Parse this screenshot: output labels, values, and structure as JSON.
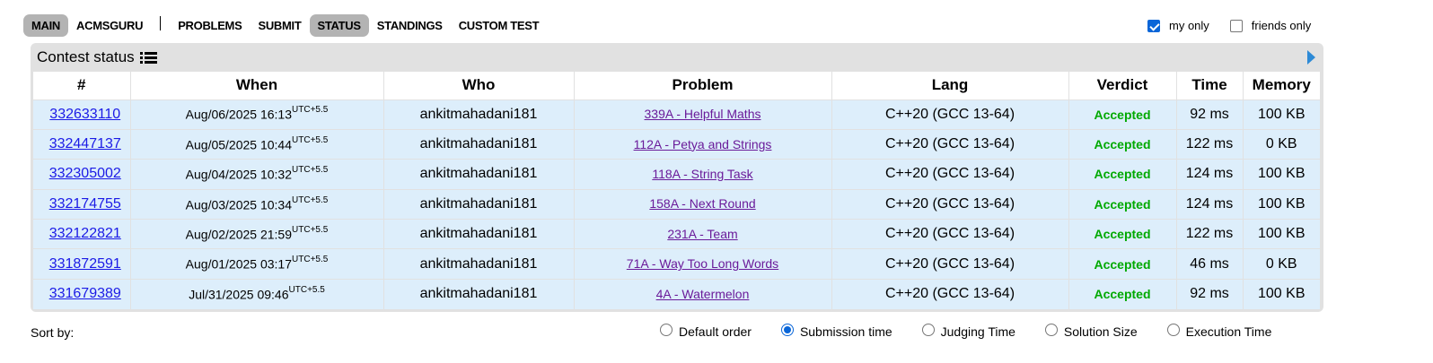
{
  "nav": {
    "items": [
      {
        "label": "MAIN",
        "active": true
      },
      {
        "label": "ACMSGURU",
        "active": false
      },
      {
        "label": "PROBLEMS",
        "active": false
      },
      {
        "label": "SUBMIT",
        "active": false
      },
      {
        "label": "STATUS",
        "active": true
      },
      {
        "label": "STANDINGS",
        "active": false
      },
      {
        "label": "CUSTOM TEST",
        "active": false
      }
    ]
  },
  "filters": {
    "my_only": {
      "label": "my only",
      "checked": true
    },
    "friends_only": {
      "label": "friends only",
      "checked": false
    }
  },
  "panel": {
    "title": "Contest status",
    "title_icon": "list-icon",
    "next_icon": "arrow-right-icon"
  },
  "table": {
    "headers": [
      "#",
      "When",
      "Who",
      "Problem",
      "Lang",
      "Verdict",
      "Time",
      "Memory"
    ],
    "rows": [
      {
        "id": "332633110",
        "when": "Aug/06/2025 16:13",
        "tz": "UTC+5.5",
        "who": "ankitmahadani181",
        "problem": "339A - Helpful Maths",
        "lang": "C++20 (GCC 13-64)",
        "verdict": "Accepted",
        "time": "92 ms",
        "memory": "100 KB"
      },
      {
        "id": "332447137",
        "when": "Aug/05/2025 10:44",
        "tz": "UTC+5.5",
        "who": "ankitmahadani181",
        "problem": "112A - Petya and Strings",
        "lang": "C++20 (GCC 13-64)",
        "verdict": "Accepted",
        "time": "122 ms",
        "memory": "0 KB"
      },
      {
        "id": "332305002",
        "when": "Aug/04/2025 10:32",
        "tz": "UTC+5.5",
        "who": "ankitmahadani181",
        "problem": "118A - String Task",
        "lang": "C++20 (GCC 13-64)",
        "verdict": "Accepted",
        "time": "124 ms",
        "memory": "100 KB"
      },
      {
        "id": "332174755",
        "when": "Aug/03/2025 10:34",
        "tz": "UTC+5.5",
        "who": "ankitmahadani181",
        "problem": "158A - Next Round",
        "lang": "C++20 (GCC 13-64)",
        "verdict": "Accepted",
        "time": "124 ms",
        "memory": "100 KB"
      },
      {
        "id": "332122821",
        "when": "Aug/02/2025 21:59",
        "tz": "UTC+5.5",
        "who": "ankitmahadani181",
        "problem": "231A - Team",
        "lang": "C++20 (GCC 13-64)",
        "verdict": "Accepted",
        "time": "122 ms",
        "memory": "100 KB"
      },
      {
        "id": "331872591",
        "when": "Aug/01/2025 03:17",
        "tz": "UTC+5.5",
        "who": "ankitmahadani181",
        "problem": "71A - Way Too Long Words",
        "lang": "C++20 (GCC 13-64)",
        "verdict": "Accepted",
        "time": "46 ms",
        "memory": "0 KB"
      },
      {
        "id": "331679389",
        "when": "Jul/31/2025 09:46",
        "tz": "UTC+5.5",
        "who": "ankitmahadani181",
        "problem": "4A - Watermelon",
        "lang": "C++20 (GCC 13-64)",
        "verdict": "Accepted",
        "time": "92 ms",
        "memory": "100 KB"
      }
    ]
  },
  "sort": {
    "label": "Sort by:",
    "options": [
      {
        "label": "Default order",
        "checked": false
      },
      {
        "label": "Submission time",
        "checked": true
      },
      {
        "label": "Judging Time",
        "checked": false
      },
      {
        "label": "Solution Size",
        "checked": false
      },
      {
        "label": "Execution Time",
        "checked": false
      }
    ]
  },
  "colors": {
    "row_bg": "#ddeefb",
    "verdict_accepted": "#00a900",
    "link": "#1a1ae6",
    "problem_link": "#6a1b9a",
    "active_nav": "#b3b3b3",
    "panel_bg": "#e1e1e1"
  }
}
